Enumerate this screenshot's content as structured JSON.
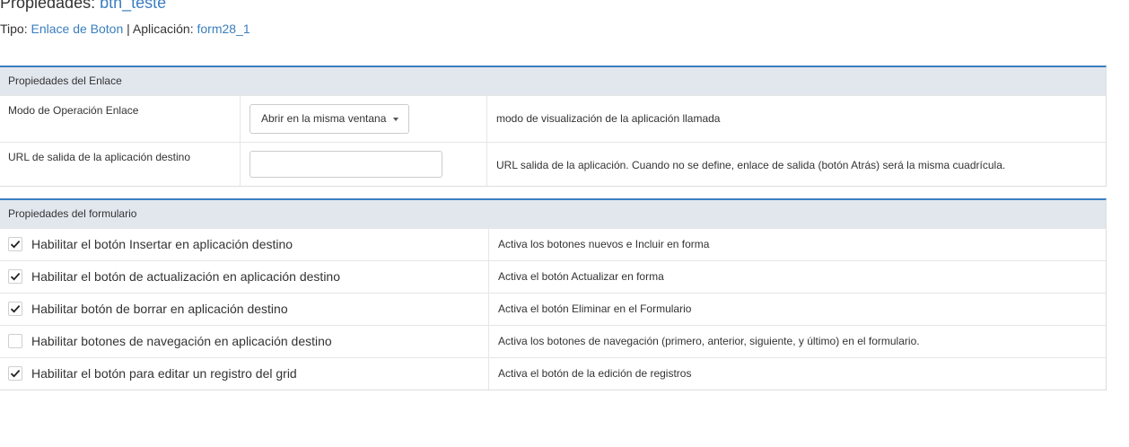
{
  "header": {
    "title_prefix": "Propiedades:",
    "title_name": "btn_teste",
    "type_label": "Tipo:",
    "type_value": "Enlace de Boton",
    "separator": "|",
    "app_label": "Aplicación:",
    "app_value": "form28_1"
  },
  "link_section": {
    "title": "Propiedades del Enlace",
    "rows": [
      {
        "label": "Modo de Operación Enlace",
        "select_value": "Abrir en la misma ventana",
        "help": "modo de visualización de la aplicación llamada"
      },
      {
        "label": "URL de salida de la aplicación destino",
        "input_value": "",
        "help": "URL salida de la aplicación. Cuando no se define, enlace de salida (botón Atrás) será la misma cuadrícula."
      }
    ]
  },
  "form_section": {
    "title": "Propiedades del formulario",
    "rows": [
      {
        "label": "Habilitar el botón Insertar en aplicación destino",
        "checked": true,
        "help": "Activa los botones nuevos e Incluir en forma"
      },
      {
        "label": "Habilitar el botón de actualización en aplicación destino",
        "checked": true,
        "help": "Activa el botón Actualizar en forma"
      },
      {
        "label": "Habilitar botón de borrar en aplicación destino",
        "checked": true,
        "help": "Activa el botón Eliminar en el Formulario"
      },
      {
        "label": "Habilitar botones de navegación en aplicación destino",
        "checked": false,
        "help": "Activa los botones de navegación (primero, anterior, siguiente, y último) en el formulario."
      },
      {
        "label": "Habilitar el botón para editar un registro del grid",
        "checked": true,
        "help": "Activa el botón de la edición de registros"
      }
    ]
  },
  "colors": {
    "accent": "#3a7ebf",
    "section_header_bg": "#e2e7ee"
  }
}
